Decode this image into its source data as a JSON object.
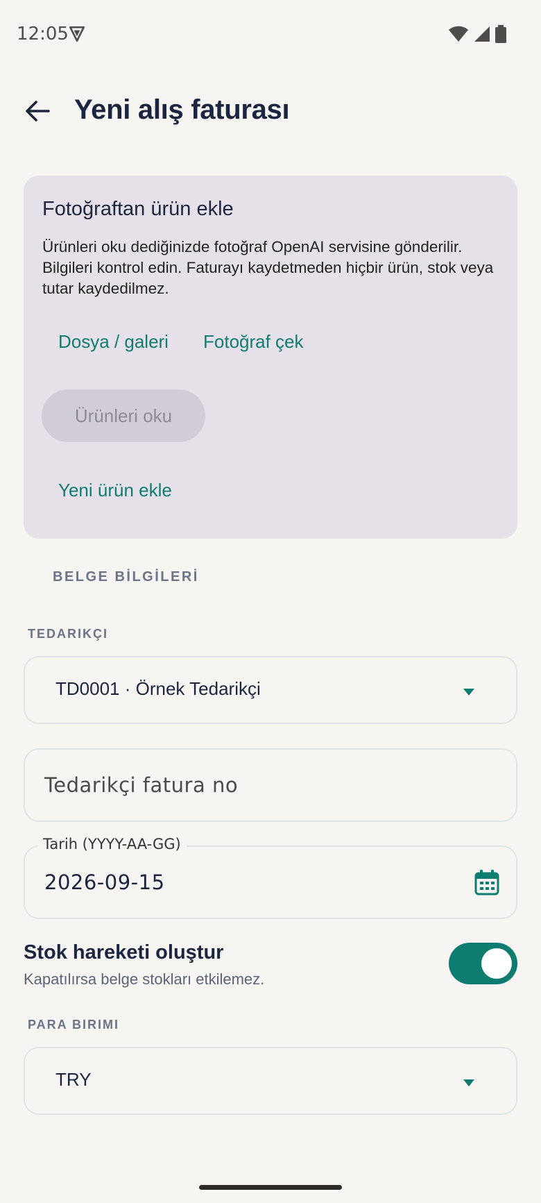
{
  "status_bar": {
    "time": "12:05",
    "icons": [
      "shield-icon",
      "wifi-icon",
      "signal-icon",
      "battery-icon"
    ]
  },
  "app_bar": {
    "title": "Yeni alış faturası",
    "back_icon": "arrow-left-icon"
  },
  "photo_card": {
    "title": "Fotoğraftan ürün ekle",
    "description": "Ürünleri oku dediğinizde fotoğraf OpenAI servisine gönderilir. Bilgileri kontrol edin. Faturayı kaydetmeden hiçbir ürün, stok veya tutar kaydedilmez.",
    "file_button": "Dosya / galeri",
    "camera_button": "Fotoğraf çek",
    "read_button": "Ürünleri oku",
    "read_button_enabled": false,
    "new_product_button": "Yeni ürün ekle"
  },
  "document_section": {
    "header": "BELGE BİLGİLERİ",
    "supplier_label": "TEDARIKÇI",
    "supplier_value": "TD0001 · Örnek Tedarikçi",
    "invoice_no_placeholder": "Tedarikçi fatura no",
    "date_label": "Tarih (YYYY-AA-GG)",
    "date_value": "2026-09-15",
    "stock_toggle_title": "Stok hareketi oluştur",
    "stock_toggle_subtitle": "Kapatılırsa belge stokları etkilemez.",
    "stock_toggle_on": true,
    "currency_label": "PARA BIRIMI",
    "currency_value": "TRY"
  },
  "colors": {
    "accent": "#0e7c71",
    "card_bg": "#e6e1e8",
    "page_bg": "#f6f5f1",
    "title": "#1c2540"
  }
}
